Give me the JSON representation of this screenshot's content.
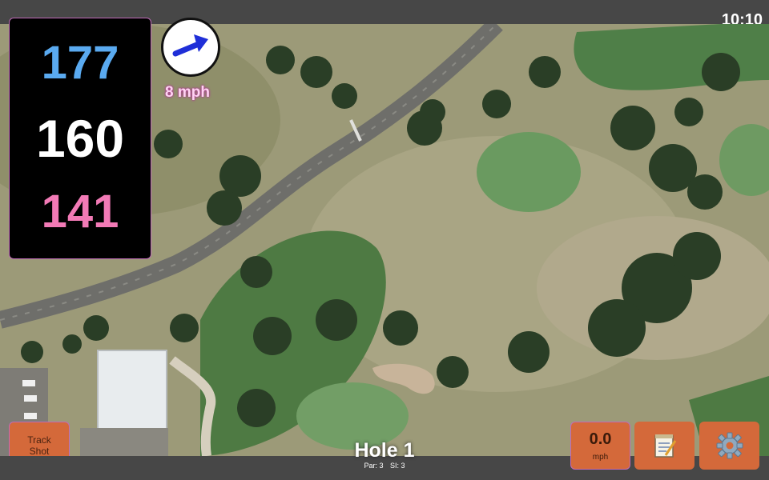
{
  "status_bar": {
    "time": "10:10"
  },
  "yardages": {
    "back": "177",
    "middle": "160",
    "front": "141"
  },
  "wind": {
    "speed_label": "8 mph",
    "arrow_icon": "arrow-up-right-icon"
  },
  "track_shot": {
    "line1": "Track",
    "line2": "Shot"
  },
  "hole": {
    "title": "Hole 1",
    "par": "Par: 3",
    "si": "SI: 3"
  },
  "speed": {
    "value": "0.0",
    "unit": "mph"
  },
  "toolbar": {
    "notes_icon": "notepad-icon",
    "settings_icon": "gear-icon"
  },
  "colors": {
    "back_yard": "#5aaaf0",
    "middle_yard": "#ffffff",
    "front_yard": "#f27ab6",
    "button": "#d4693a",
    "accent": "#c06ab8"
  }
}
